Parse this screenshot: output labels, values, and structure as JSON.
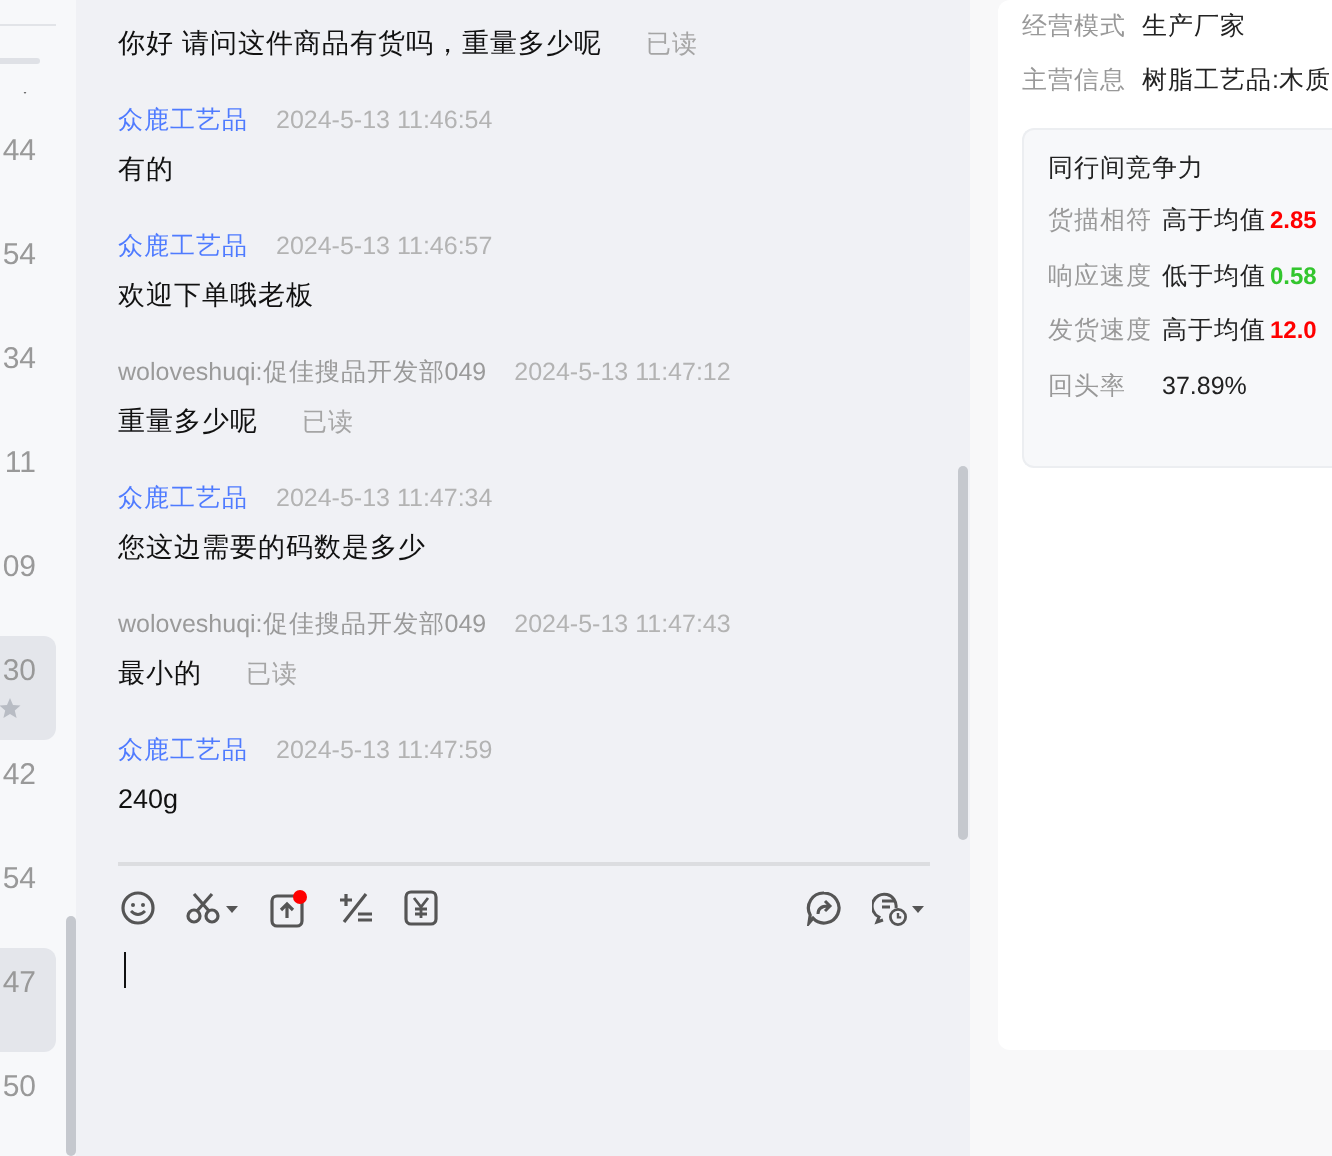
{
  "toggle": {
    "on": false
  },
  "conversations": [
    {
      "time": "44",
      "selected": false,
      "starred": false
    },
    {
      "time": "54",
      "selected": false,
      "starred": false
    },
    {
      "time": "34",
      "selected": false,
      "starred": false
    },
    {
      "time": "11",
      "selected": false,
      "starred": false
    },
    {
      "time": "09",
      "selected": false,
      "starred": false
    },
    {
      "time": "30",
      "selected": true,
      "starred": true
    },
    {
      "time": "42",
      "selected": false,
      "starred": false
    },
    {
      "time": "54",
      "selected": false,
      "starred": false
    },
    {
      "time": "47",
      "selected": true,
      "starred": false
    },
    {
      "time": "50",
      "selected": false,
      "starred": false
    }
  ],
  "messages": [
    {
      "kind": "customer",
      "text": "你好 请问这件商品有货吗，重量多少呢",
      "status": "已读"
    },
    {
      "kind": "shop",
      "sender": "众鹿工艺品",
      "time": "2024-5-13 11:46:54",
      "text": "有的"
    },
    {
      "kind": "shop",
      "sender": "众鹿工艺品",
      "time": "2024-5-13 11:46:57",
      "text": "欢迎下单哦老板"
    },
    {
      "kind": "customer",
      "sender": "woloveshuqi:促佳搜品开发部049",
      "time": "2024-5-13 11:47:12",
      "text": "重量多少呢",
      "status": "已读"
    },
    {
      "kind": "shop",
      "sender": "众鹿工艺品",
      "time": "2024-5-13 11:47:34",
      "text": "您这边需要的码数是多少"
    },
    {
      "kind": "customer",
      "sender": "woloveshuqi:促佳搜品开发部049",
      "time": "2024-5-13 11:47:43",
      "text": "最小的",
      "status": "已读"
    },
    {
      "kind": "shop",
      "sender": "众鹿工艺品",
      "time": "2024-5-13 11:47:59",
      "text": "240g"
    }
  ],
  "supplier_info": [
    {
      "label": "经营模式",
      "value": "生产厂家"
    },
    {
      "label": "主营信息",
      "value": "树脂工艺品:木质"
    }
  ],
  "competitiveness": {
    "title": "同行间竞争力",
    "rows": [
      {
        "label": "货描相符",
        "value": "高于均值",
        "figure": "2.85",
        "color": "#ff0000"
      },
      {
        "label": "响应速度",
        "value": "低于均值",
        "figure": "0.58",
        "color": "#33c62e"
      },
      {
        "label": "发货速度",
        "value": "高于均值",
        "figure": "12.0",
        "color": "#ff0000"
      },
      {
        "label": "回头率",
        "value": "37.89%"
      }
    ]
  }
}
